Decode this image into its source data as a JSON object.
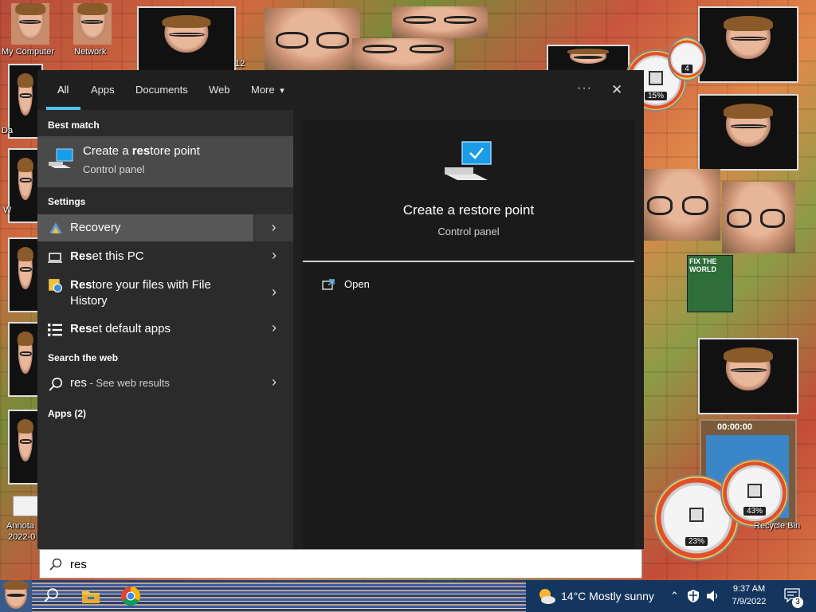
{
  "desktop": {
    "icons": [
      {
        "label": "My Computer"
      },
      {
        "label": "Network"
      },
      {
        "label": "Annota"
      },
      {
        "label": "2022-0"
      },
      {
        "label": "Recycle Bin"
      },
      {
        "label": "Da"
      },
      {
        "label": "W"
      }
    ],
    "gadgets": {
      "cpu_top": "15%",
      "cpu_top2": "4",
      "cpu_bottom": "23%",
      "mem_bottom": "43%",
      "timer": "00:00:00"
    },
    "book_title": "FIX THE WORLD",
    "num_fragment": "12"
  },
  "search": {
    "tabs": [
      "All",
      "Apps",
      "Documents",
      "Web",
      "More"
    ],
    "active_tab": "All",
    "more_caret": "▾",
    "options_label": "···",
    "close_label": "✕",
    "best_match_heading": "Best match",
    "best_match": {
      "title_pre": "Create a ",
      "title_bold": "res",
      "title_post": "tore point",
      "subtitle": "Control panel"
    },
    "settings_heading": "Settings",
    "settings_items": [
      {
        "pre": "",
        "bold": "",
        "post": "Recovery"
      },
      {
        "pre": "",
        "bold": "Res",
        "post": "et this PC"
      },
      {
        "pre": "",
        "bold": "Res",
        "post": "tore your files with File History"
      },
      {
        "pre": "",
        "bold": "Res",
        "post": "et default apps"
      }
    ],
    "web_heading": "Search the web",
    "web_item": {
      "query": "res",
      "suffix": " - See web results"
    },
    "apps_heading": "Apps (2)",
    "detail": {
      "title": "Create a restore point",
      "subtitle": "Control panel",
      "open_label": "Open"
    },
    "query": "res"
  },
  "taskbar": {
    "weather": "14°C  Mostly sunny",
    "time": "9:37 AM",
    "date": "7/9/2022",
    "notification_count": "3"
  },
  "colors": {
    "accent": "#4cc2ff",
    "panel": "#1f1f1f",
    "selected": "#575757"
  }
}
